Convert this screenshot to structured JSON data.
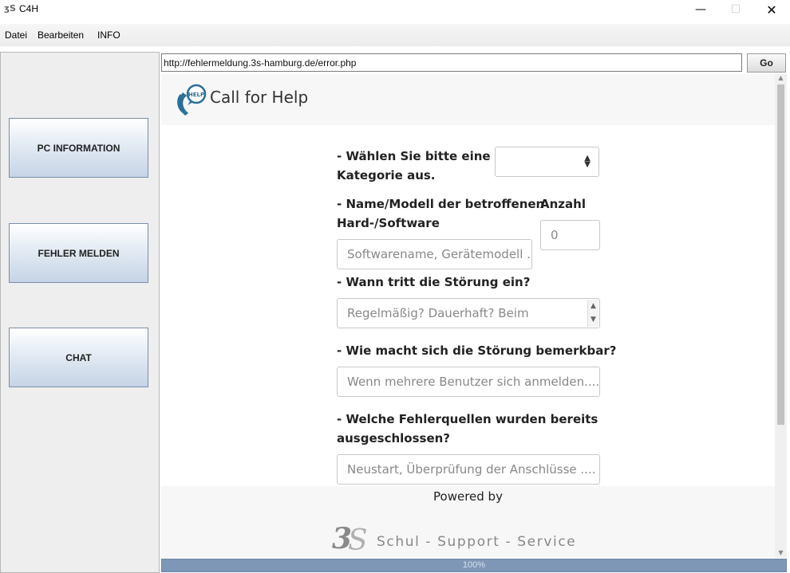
{
  "window": {
    "title": "C4H",
    "icon_text": "3S"
  },
  "menu": {
    "items": [
      "Datei",
      "Bearbeiten",
      "INFO"
    ]
  },
  "sidebar": {
    "buttons": [
      "PC INFORMATION",
      "FEHLER MELDEN",
      "CHAT"
    ]
  },
  "address_bar": {
    "url": "http://fehlermeldung.3s-hamburg.de/error.php",
    "go_label": "Go"
  },
  "page": {
    "header_title": "Call for Help",
    "help_badge": "HELP",
    "form": {
      "category_label_1": "- Wählen Sie bitte eine",
      "category_label_2": "Kategorie aus.",
      "category_value": "",
      "name_label_1": "- Name/Modell der betroffenen",
      "name_label_2": "Hard-/Software",
      "name_placeholder": "Softwarename, Gerätemodell ...",
      "count_label": "Anzahl",
      "count_value": "0",
      "when_label": "- Wann tritt die Störung ein?",
      "when_placeholder": "Regelmäßig? Dauerhaft? Beim",
      "how_label": "- Wie macht sich die Störung bemerkbar?",
      "how_placeholder": "Wenn mehrere Benutzer sich anmelden....",
      "sources_label_1": "- Welche Fehlerquellen wurden bereits",
      "sources_label_2": "ausgeschlossen?",
      "sources_placeholder": "Neustart, Überprüfung der Anschlüsse ...."
    },
    "footer": {
      "powered_by": "Powered by",
      "brand_name": "Schul - Support - Service"
    }
  },
  "progress": {
    "percent": 100,
    "text": "100%"
  },
  "colors": {
    "button_blue": "#c5d4e6",
    "progress_blue": "#7e97b7"
  }
}
